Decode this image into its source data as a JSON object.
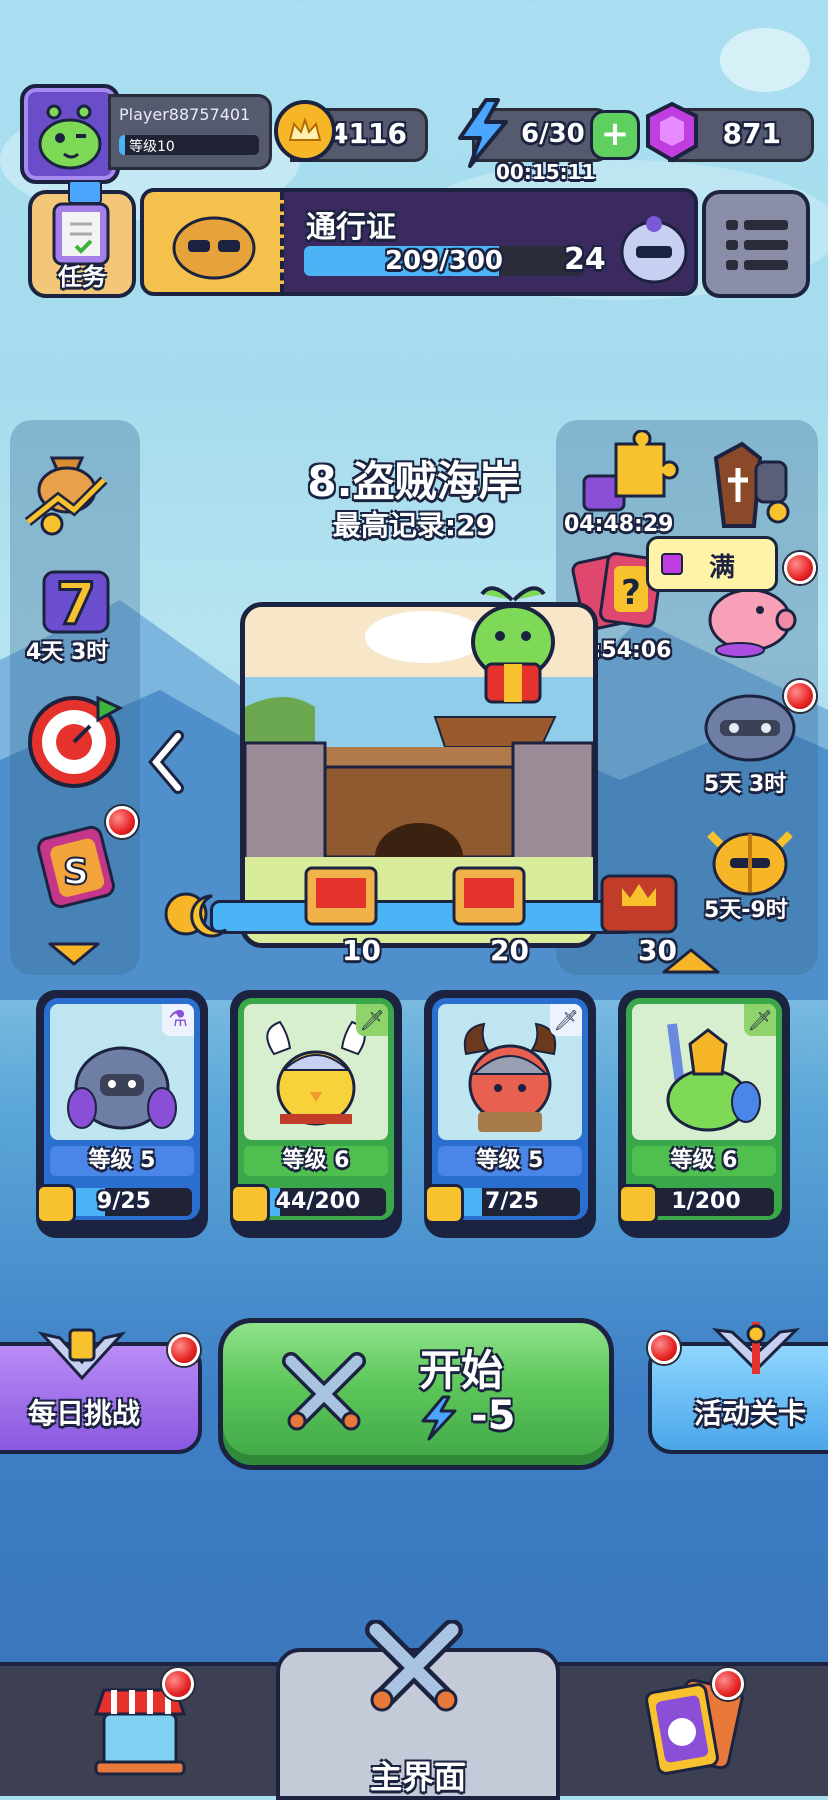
{
  "player": {
    "name": "Player88757401",
    "level": "等级10"
  },
  "resources": {
    "crowns": "4116",
    "energy": "6/30",
    "energy_timer": "00:15:11",
    "gems": "871"
  },
  "quest_button": {
    "label": "任务"
  },
  "battle_pass": {
    "title": "通行证",
    "progress": "209/300",
    "progress_value": 0.697,
    "level": "24"
  },
  "stage": {
    "name": "8.盗贼海岸",
    "best_record": "最高记录:29"
  },
  "left_events": [
    {
      "timer": ""
    },
    {
      "timer": "4天 3时"
    },
    {
      "timer": ""
    },
    {
      "timer": ""
    }
  ],
  "right_events": {
    "puzzle_timer": "04:48:29",
    "card_pack_timer": "00:54:06",
    "piggy_bank_label": "满",
    "event_3_timer": "5天 3时",
    "event_4_timer": "5天-9时"
  },
  "rewards": [
    {
      "cost": "10"
    },
    {
      "cost": "20"
    },
    {
      "cost": "30"
    }
  ],
  "heroes": [
    {
      "level": "等级 5",
      "progress": "9/25",
      "progress_value": 0.36,
      "theme": "blue"
    },
    {
      "level": "等级 6",
      "progress": "44/200",
      "progress_value": 0.22,
      "theme": "green"
    },
    {
      "level": "等级 5",
      "progress": "7/25",
      "progress_value": 0.28,
      "theme": "blue"
    },
    {
      "level": "等级 6",
      "progress": "1/200",
      "progress_value": 0.05,
      "theme": "green"
    }
  ],
  "buttons": {
    "daily_challenge": "每日挑战",
    "start": "开始",
    "start_cost": "-5",
    "event_stage": "活动关卡"
  },
  "bottom_nav": {
    "home": "主界面"
  }
}
